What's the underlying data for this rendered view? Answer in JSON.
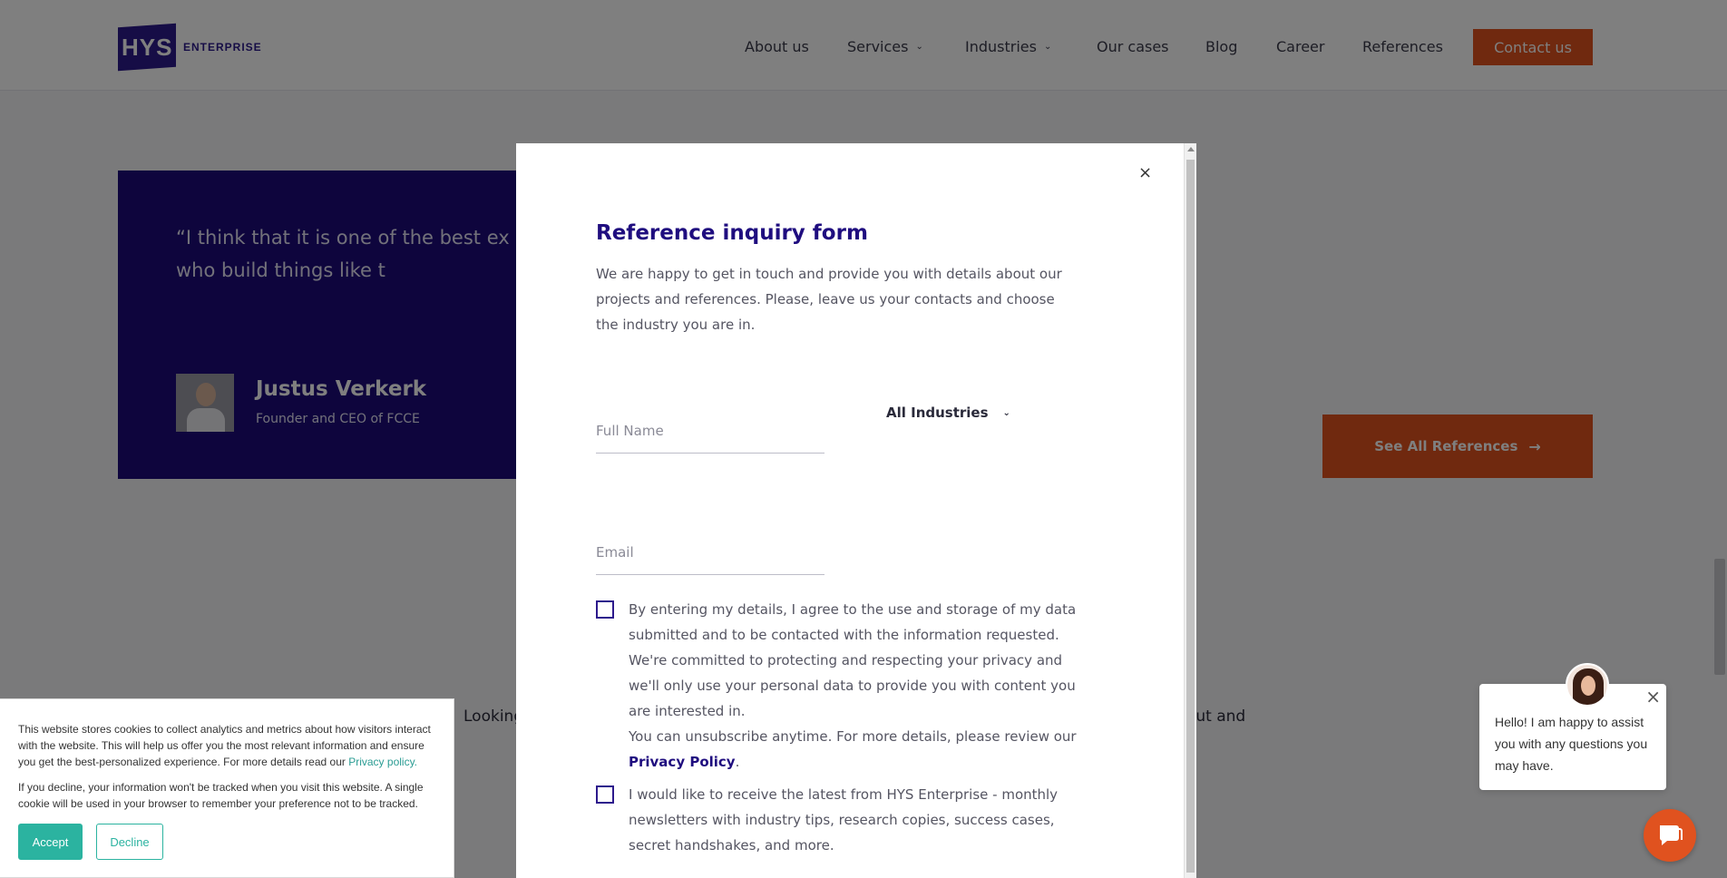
{
  "header": {
    "logo_mark": "HYS",
    "logo_sub": "ENTERPRISE",
    "nav": [
      {
        "label": "About us",
        "dropdown": false
      },
      {
        "label": "Services",
        "dropdown": true
      },
      {
        "label": "Industries",
        "dropdown": true
      },
      {
        "label": "Our cases",
        "dropdown": false
      },
      {
        "label": "Blog",
        "dropdown": false
      },
      {
        "label": "Career",
        "dropdown": false
      },
      {
        "label": "References",
        "dropdown": false
      }
    ],
    "contact_label": "Contact us"
  },
  "testimonial": {
    "quote": "“I think that it is one of the best ex with people who build things like t",
    "name": "Justus Verkerk",
    "role": "Founder and CEO of FCCE"
  },
  "see_all_label": "See All References",
  "looking_left": "Looking",
  "looking_right": "out and",
  "modal": {
    "close_label": "×",
    "title": "Reference inquiry form",
    "description": "We are happy to get in touch and provide you with details about our projects and references. Please, leave us your contacts and choose the industry you are in.",
    "full_name_placeholder": "Full Name",
    "industry_selected": "All Industries",
    "email_placeholder": "Email",
    "consent_text": "By entering my details, I agree to the use and storage of my data submitted and to be contacted with the information requested. We're committed to protecting and respecting your privacy and we'll only use your personal data to provide you with content you are interested in.",
    "consent_text_2": "You can unsubscribe anytime. For more details, please review our",
    "privacy_link": "Privacy Policy",
    "newsletter_text": "I would like to receive the latest from HYS Enterprise - monthly newsletters with industry tips, research copies, success cases, secret handshakes, and more."
  },
  "cookie": {
    "text_1": "This website stores cookies to collect analytics and metrics about how visitors interact with the website. This will help us offer you the most relevant information and ensure you get the best-personalized experience. For more details read our",
    "privacy_link": "Privacy policy.",
    "text_2": "If you decline, your information won't be tracked when you visit this website. A single cookie will be used in your browser to remember your preference not to be tracked.",
    "accept_label": "Accept",
    "decline_label": "Decline"
  },
  "chat": {
    "message": "Hello! I am happy to assist you with any questions you may have.",
    "close_label": "×"
  },
  "colors": {
    "brand_navy": "#1f0d7f",
    "accent_orange": "#e0521f",
    "cookie_teal": "#2bb3a0"
  }
}
